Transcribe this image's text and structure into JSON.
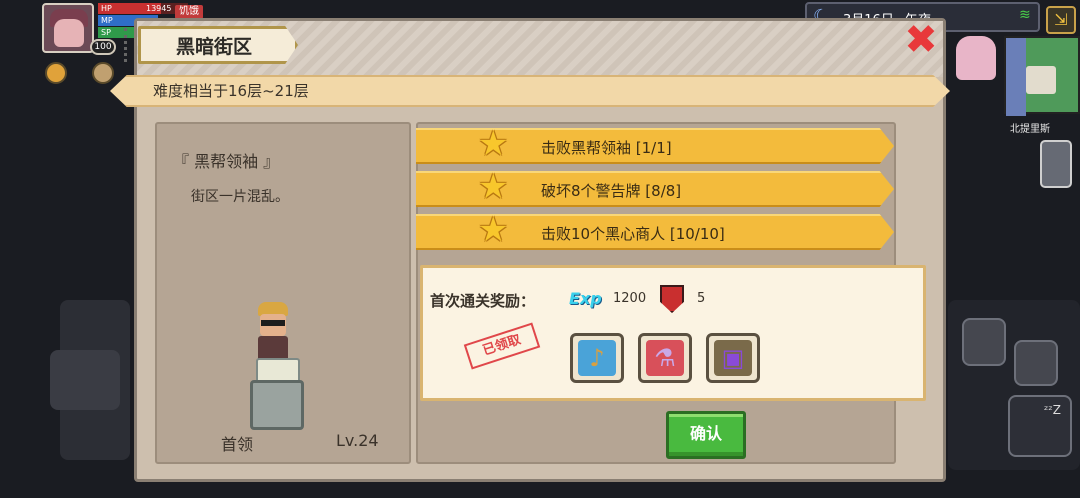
{
  "hud": {
    "hp_label": "HP",
    "hp_value": "13945",
    "mp_label": "MP",
    "sp_label": "SP",
    "level": "100",
    "status": "饥饿"
  },
  "top_right": {
    "date": "3月16日",
    "time_of_day": "午夜",
    "location": "北提里斯"
  },
  "dialog": {
    "title": "黑暗街区",
    "difficulty": "难度相当于16层~21层",
    "boss": {
      "name": "『 黑帮领袖 』",
      "description": "街区一片混乱。",
      "label": "首领",
      "level": "Lv.24"
    },
    "objectives": [
      {
        "text": "击败黑帮领袖 [1/1]"
      },
      {
        "text": "破坏8个警告牌 [8/8]"
      },
      {
        "text": "击败10个黑心商人 [10/10]"
      }
    ],
    "reward": {
      "label": "首次通关奖励：",
      "exp_icon_text": "Exp",
      "exp_value": "1200",
      "token_value": "5",
      "claimed_stamp": "已领取",
      "items": [
        {
          "icon": "guitar-icon",
          "color": "#4aa3d8"
        },
        {
          "icon": "potion-icon",
          "color": "#d8505a"
        },
        {
          "icon": "chest-icon",
          "color": "#7a6a4a"
        }
      ]
    },
    "confirm_label": "确认"
  },
  "colors": {
    "objective_bg": "#f3bb3c",
    "confirm_green": "#49ba3f",
    "close_red": "#e8383a"
  }
}
